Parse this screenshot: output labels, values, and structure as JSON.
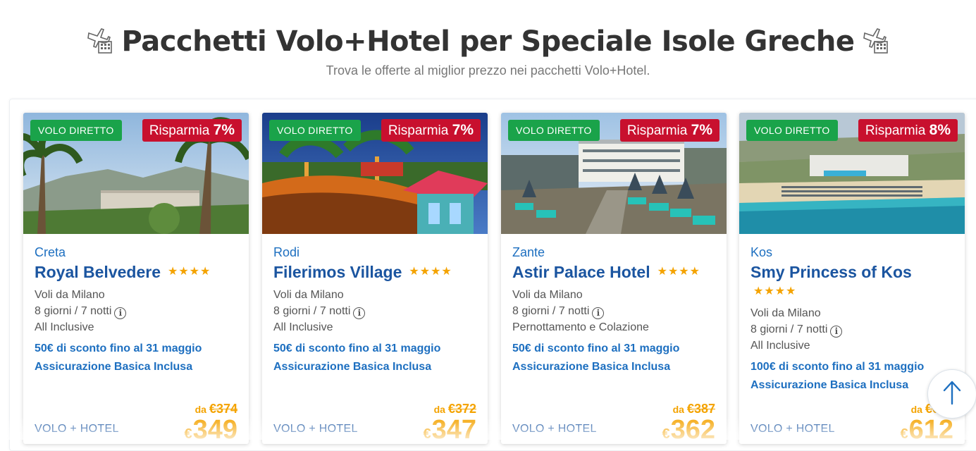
{
  "header": {
    "title": "Pacchetti Volo+Hotel per Speciale Isole Greche",
    "subtitle": "Trova le offerte al miglior prezzo nei pacchetti Volo+Hotel.",
    "icon": "plane-hotel-icon"
  },
  "cards": [
    {
      "badge_direct": "VOLO DIRETTO",
      "save_label": "Risparmia",
      "save_pct": "7%",
      "destination": "Creta",
      "hotel": "Royal Belvedere",
      "stars": "★★★★",
      "departure": "Voli da Milano",
      "duration": "8 giorni / 7 notti",
      "board": "All Inclusive",
      "promo1": "50€ di sconto fino al 31 maggio",
      "promo2": "Assicurazione Basica Inclusa",
      "package_label": "VOLO + HOTEL",
      "price_from": "da",
      "old_price": "€374",
      "currency": "€",
      "price": "349"
    },
    {
      "badge_direct": "VOLO DIRETTO",
      "save_label": "Risparmia",
      "save_pct": "7%",
      "destination": "Rodi",
      "hotel": "Filerimos Village",
      "stars": "★★★★",
      "departure": "Voli da Milano",
      "duration": "8 giorni / 7 notti",
      "board": "All Inclusive",
      "promo1": "50€ di sconto fino al 31 maggio",
      "promo2": "Assicurazione Basica Inclusa",
      "package_label": "VOLO + HOTEL",
      "price_from": "da",
      "old_price": "€372",
      "currency": "€",
      "price": "347"
    },
    {
      "badge_direct": "VOLO DIRETTO",
      "save_label": "Risparmia",
      "save_pct": "7%",
      "destination": "Zante",
      "hotel": "Astir Palace Hotel",
      "stars": "★★★★",
      "departure": "Voli da Milano",
      "duration": "8 giorni / 7 notti",
      "board": "Pernottamento e Colazione",
      "promo1": "50€ di sconto fino al 31 maggio",
      "promo2": "Assicurazione Basica Inclusa",
      "package_label": "VOLO + HOTEL",
      "price_from": "da",
      "old_price": "€387",
      "currency": "€",
      "price": "362"
    },
    {
      "badge_direct": "VOLO DIRETTO",
      "save_label": "Risparmia",
      "save_pct": "8%",
      "destination": "Kos",
      "hotel": "Smy Princess of Kos",
      "stars": "★★★★",
      "departure": "Voli da Milano",
      "duration": "8 giorni / 7 notti",
      "board": "All Inclusive",
      "promo1": "100€ di sconto fino al 31 maggio",
      "promo2": "Assicurazione Basica Inclusa",
      "package_label": "VOLO + HOTEL",
      "price_from": "da",
      "old_price": "€662",
      "currency": "€",
      "price": "612"
    }
  ],
  "colors": {
    "brand_blue": "#1b55a0",
    "link_blue": "#1d6fc0",
    "price_orange": "#f4a300",
    "save_red": "#c8102e",
    "direct_green": "#1aa34a"
  },
  "scroll_top": {
    "icon": "arrow-up-icon"
  }
}
